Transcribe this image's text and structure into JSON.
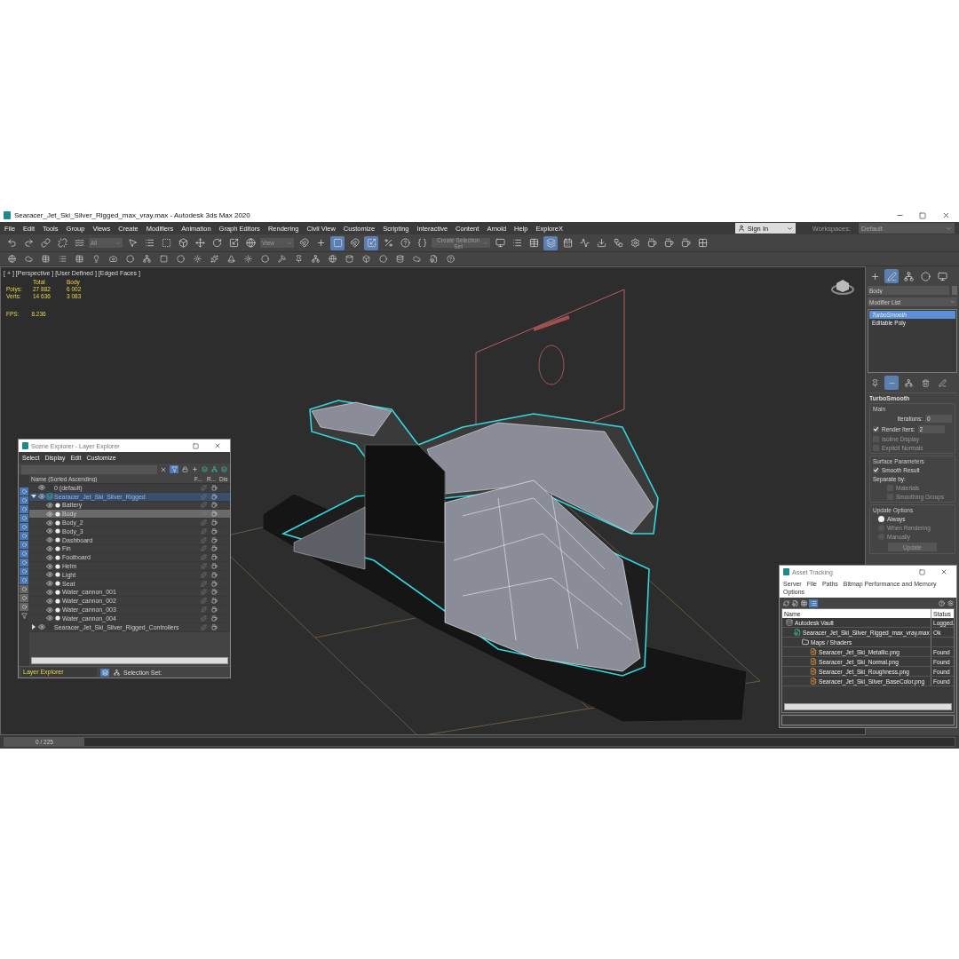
{
  "window": {
    "title": "Searacer_Jet_Ski_Silver_Rigged_max_vray.max - Autodesk 3ds Max 2020"
  },
  "menu": [
    "File",
    "Edit",
    "Tools",
    "Group",
    "Views",
    "Create",
    "Modifiers",
    "Animation",
    "Graph Editors",
    "Rendering",
    "Civil View",
    "Customize",
    "Scripting",
    "Interactive",
    "Content",
    "Arnold",
    "Help",
    "ExploreX"
  ],
  "sign_in": {
    "label": "Sign In"
  },
  "workspaces": {
    "label": "Workspaces:",
    "value": "Default"
  },
  "toolbar": {
    "selection_filter": "All",
    "reference_coord": "View",
    "selection_set_placeholder": "Create Selection Set"
  },
  "viewport": {
    "label": "[ + ] [Perspective ] [User Defined ] [Edged Faces ]",
    "stats": {
      "headers": [
        "Total",
        "Body"
      ],
      "rows": [
        {
          "label": "Polys:",
          "values": [
            "27 882",
            "6 002"
          ]
        },
        {
          "label": "Verts:",
          "values": [
            "14 636",
            "3 083"
          ]
        }
      ],
      "fps_label": "FPS:",
      "fps": "8.236"
    }
  },
  "scene_explorer": {
    "title": "Scene Explorer - Layer Explorer",
    "menu": [
      "Select",
      "Display",
      "Edit",
      "Customize"
    ],
    "columns": [
      "Name (Sorted Ascending)",
      "F...",
      "R...",
      "Dis"
    ],
    "tree": [
      {
        "label": "0 (default)",
        "kind": "layer",
        "selected": false
      },
      {
        "label": "Searacer_Jet_Ski_Silver_Rigged",
        "kind": "layer",
        "selected": true,
        "expanded": true,
        "children": [
          {
            "label": "Battery",
            "kind": "object",
            "selected": false
          },
          {
            "label": "Body",
            "kind": "object",
            "selected": true
          },
          {
            "label": "Body_2",
            "kind": "object",
            "selected": false
          },
          {
            "label": "Body_3",
            "kind": "object",
            "selected": false
          },
          {
            "label": "Dashboard",
            "kind": "object",
            "selected": false
          },
          {
            "label": "Fin",
            "kind": "object",
            "selected": false
          },
          {
            "label": "Footboard",
            "kind": "object",
            "selected": false
          },
          {
            "label": "Helm",
            "kind": "object",
            "selected": false
          },
          {
            "label": "Light",
            "kind": "object",
            "selected": false
          },
          {
            "label": "Seat",
            "kind": "object",
            "selected": false
          },
          {
            "label": "Water_cannon_001",
            "kind": "object",
            "selected": false
          },
          {
            "label": "Water_cannon_002",
            "kind": "object",
            "selected": false
          },
          {
            "label": "Water_cannon_003",
            "kind": "object",
            "selected": false
          },
          {
            "label": "Water_cannon_004",
            "kind": "object",
            "selected": false
          }
        ]
      },
      {
        "label": "Searacer_Jet_Ski_Silver_Rigged_Controllers",
        "kind": "layer",
        "selected": false,
        "expanded": false
      }
    ],
    "explorer_type": "Layer Explorer",
    "selection_set_label": "Selection Set:"
  },
  "command_panel": {
    "object_name": "Body",
    "modifier_list": "Modifier List",
    "stack": [
      {
        "label": "TurboSmooth",
        "selected": true
      },
      {
        "label": "Editable Poly",
        "selected": false
      }
    ],
    "rollout": {
      "title": "TurboSmooth",
      "main_label": "Main",
      "iterations": {
        "label": "Iterations:",
        "value": "0"
      },
      "render_iters": {
        "label": "Render Iters:",
        "value": "2",
        "checked": true
      },
      "options": [
        {
          "label": "Isoline Display",
          "checked": false
        },
        {
          "label": "Explicit Normals",
          "checked": false
        }
      ],
      "surface_label": "Surface Parameters",
      "smooth_result": {
        "label": "Smooth Result",
        "checked": true
      },
      "separate_label": "Separate by:",
      "separate_options": [
        {
          "label": "Materials",
          "checked": false
        },
        {
          "label": "Smoothing Groups",
          "checked": false
        }
      ],
      "update_label": "Update Options",
      "update_modes": [
        {
          "label": "Always",
          "selected": true
        },
        {
          "label": "When Rendering",
          "selected": false
        },
        {
          "label": "Manually",
          "selected": false
        }
      ],
      "update_button": "Update"
    }
  },
  "asset_tracking": {
    "title": "Asset Tracking",
    "menu": [
      "Server",
      "File",
      "Paths",
      "Bitmap Performance and Memory",
      "Options"
    ],
    "columns": [
      "Name",
      "Status"
    ],
    "rows": [
      {
        "name": "Autodesk Vault",
        "status": "Logged.",
        "kind": "server",
        "children": [
          {
            "name": "Searacer_Jet_Ski_Silver_Rigged_max_vray.max",
            "status": "Ok",
            "kind": "scene",
            "children": [
              {
                "name": "Maps / Shaders",
                "kind": "folder",
                "children": [
                  {
                    "name": "Searacer_Jet_Ski_Metallic.png",
                    "status": "Found",
                    "kind": "image"
                  },
                  {
                    "name": "Searacer_Jet_Ski_Normal.png",
                    "status": "Found",
                    "kind": "image"
                  },
                  {
                    "name": "Searacer_Jet_Ski_Roughness.png",
                    "status": "Found",
                    "kind": "image"
                  },
                  {
                    "name": "Searacer_Jet_Ski_Silver_BaseColor.png",
                    "status": "Found",
                    "kind": "image"
                  }
                ]
              }
            ]
          }
        ]
      }
    ]
  },
  "timeline": {
    "frame": "0 / 225",
    "level": 0
  }
}
